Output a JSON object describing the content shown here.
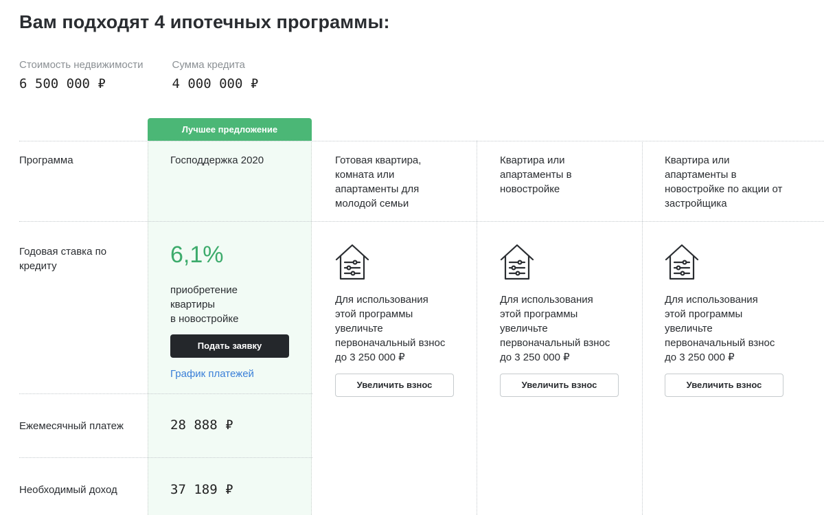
{
  "page": {
    "title": "Вам подходят 4 ипотечных программы:"
  },
  "summary": {
    "property_cost_label": "Стоимость недвижимости",
    "property_cost_value": "6 500 000 ₽",
    "loan_amount_label": "Сумма кредита",
    "loan_amount_value": "4 000 000 ₽"
  },
  "table": {
    "best_badge": "Лучшее предложение",
    "row_labels": {
      "program": "Программа",
      "rate": "Годовая ставка по кредиту",
      "monthly": "Ежемесячный платеж",
      "income": "Необходимый доход"
    },
    "best": {
      "name": "Господдержка 2020",
      "rate": "6,1%",
      "rate_desc": "приобретение\nквартиры\nв новостройке",
      "apply_label": "Подать заявку",
      "schedule_label": "График платежей",
      "monthly": "28 888 ₽",
      "income": "37 189 ₽"
    },
    "programs": [
      {
        "name": "Готовая квартира, комната или апартаменты для молодой семьи",
        "info": "Для использования\nэтой программы\nувеличьте\nпервоначальный взнос\nдо 3 250 000 ₽",
        "button_label": "Увеличить взнос",
        "icon": "house-settings-icon"
      },
      {
        "name": "Квартира или апартаменты в новостройке",
        "info": "Для использования\nэтой программы\nувеличьте\nпервоначальный взнос\nдо 3 250 000 ₽",
        "button_label": "Увеличить взнос",
        "icon": "house-settings-icon"
      },
      {
        "name": "Квартира или апартаменты в новостройке по акции от застройщика",
        "info": "Для использования\nэтой программы\nувеличьте\nпервоначальный взнос\nдо 3 250 000 ₽",
        "button_label": "Увеличить взнос",
        "icon": "house-settings-icon"
      }
    ]
  },
  "colors": {
    "accent_green": "#4bb776",
    "rate_green": "#3dab6c",
    "best_column_bg": "#f2fbf5",
    "primary_button": "#24272b",
    "link_blue": "#3a7fd8"
  }
}
